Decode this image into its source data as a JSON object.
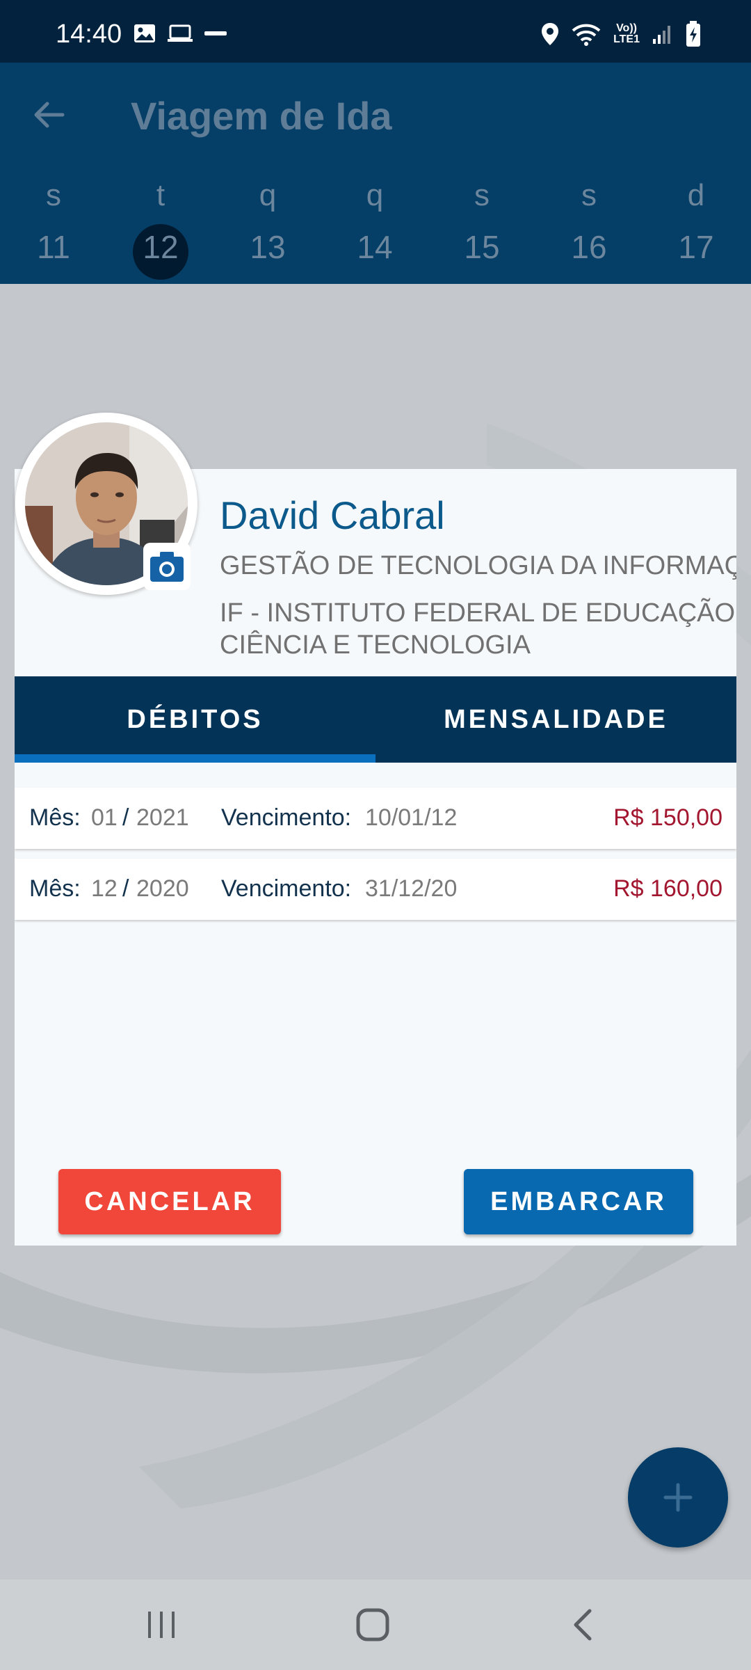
{
  "status_bar": {
    "time": "14:40",
    "left_icons": [
      "image-icon",
      "laptop-icon",
      "app-notification-icon"
    ],
    "right_icons": [
      "location-icon",
      "wifi-icon",
      "volte-icon",
      "signal-icon",
      "battery-charging-icon"
    ],
    "volte_label": "Vo))",
    "lte_label": "LTE1"
  },
  "app_bar": {
    "title": "Viagem de Ida",
    "back_icon": "arrow-left-icon"
  },
  "week": {
    "days": [
      {
        "letter": "s",
        "number": "11"
      },
      {
        "letter": "t",
        "number": "12"
      },
      {
        "letter": "q",
        "number": "13"
      },
      {
        "letter": "q",
        "number": "14"
      },
      {
        "letter": "s",
        "number": "15"
      },
      {
        "letter": "s",
        "number": "16"
      },
      {
        "letter": "d",
        "number": "17"
      }
    ],
    "selected": "12"
  },
  "dialog": {
    "user": {
      "name": "David Cabral",
      "course": "GESTÃO DE TECNOLOGIA DA INFORMAÇÃO",
      "institution": "IF - INSTITUTO FEDERAL DE EDUCAÇÃO CIÊNCIA E TECNOLOGIA",
      "avatar_icon": "profile-photo",
      "camera_icon": "camera-icon"
    },
    "tabs": [
      {
        "label": "DÉBITOS",
        "active": true
      },
      {
        "label": "MENSALIDADE",
        "active": false
      }
    ],
    "debits": [
      {
        "month_label": "Mês:",
        "month": "01",
        "year": "2021",
        "due_label": "Vencimento:",
        "due_date": "10/01/12",
        "amount": "R$ 150,00"
      },
      {
        "month_label": "Mês:",
        "month": "12",
        "year": "2020",
        "due_label": "Vencimento:",
        "due_date": "31/12/20",
        "amount": "R$ 160,00"
      }
    ],
    "buttons": {
      "cancel": "CANCELAR",
      "embark": "EMBARCAR"
    }
  },
  "fab": {
    "icon": "plus-icon"
  },
  "nav_bar": {
    "icons": [
      "recent-apps-icon",
      "home-icon",
      "back-icon"
    ]
  },
  "colors": {
    "primary_dark": "#053e66",
    "tab_bar": "#033356",
    "tab_indicator": "#0a6fbd",
    "cancel": "#f0473a",
    "embark": "#0868b0",
    "amount": "#a3162f",
    "name": "#0b5a8b"
  }
}
